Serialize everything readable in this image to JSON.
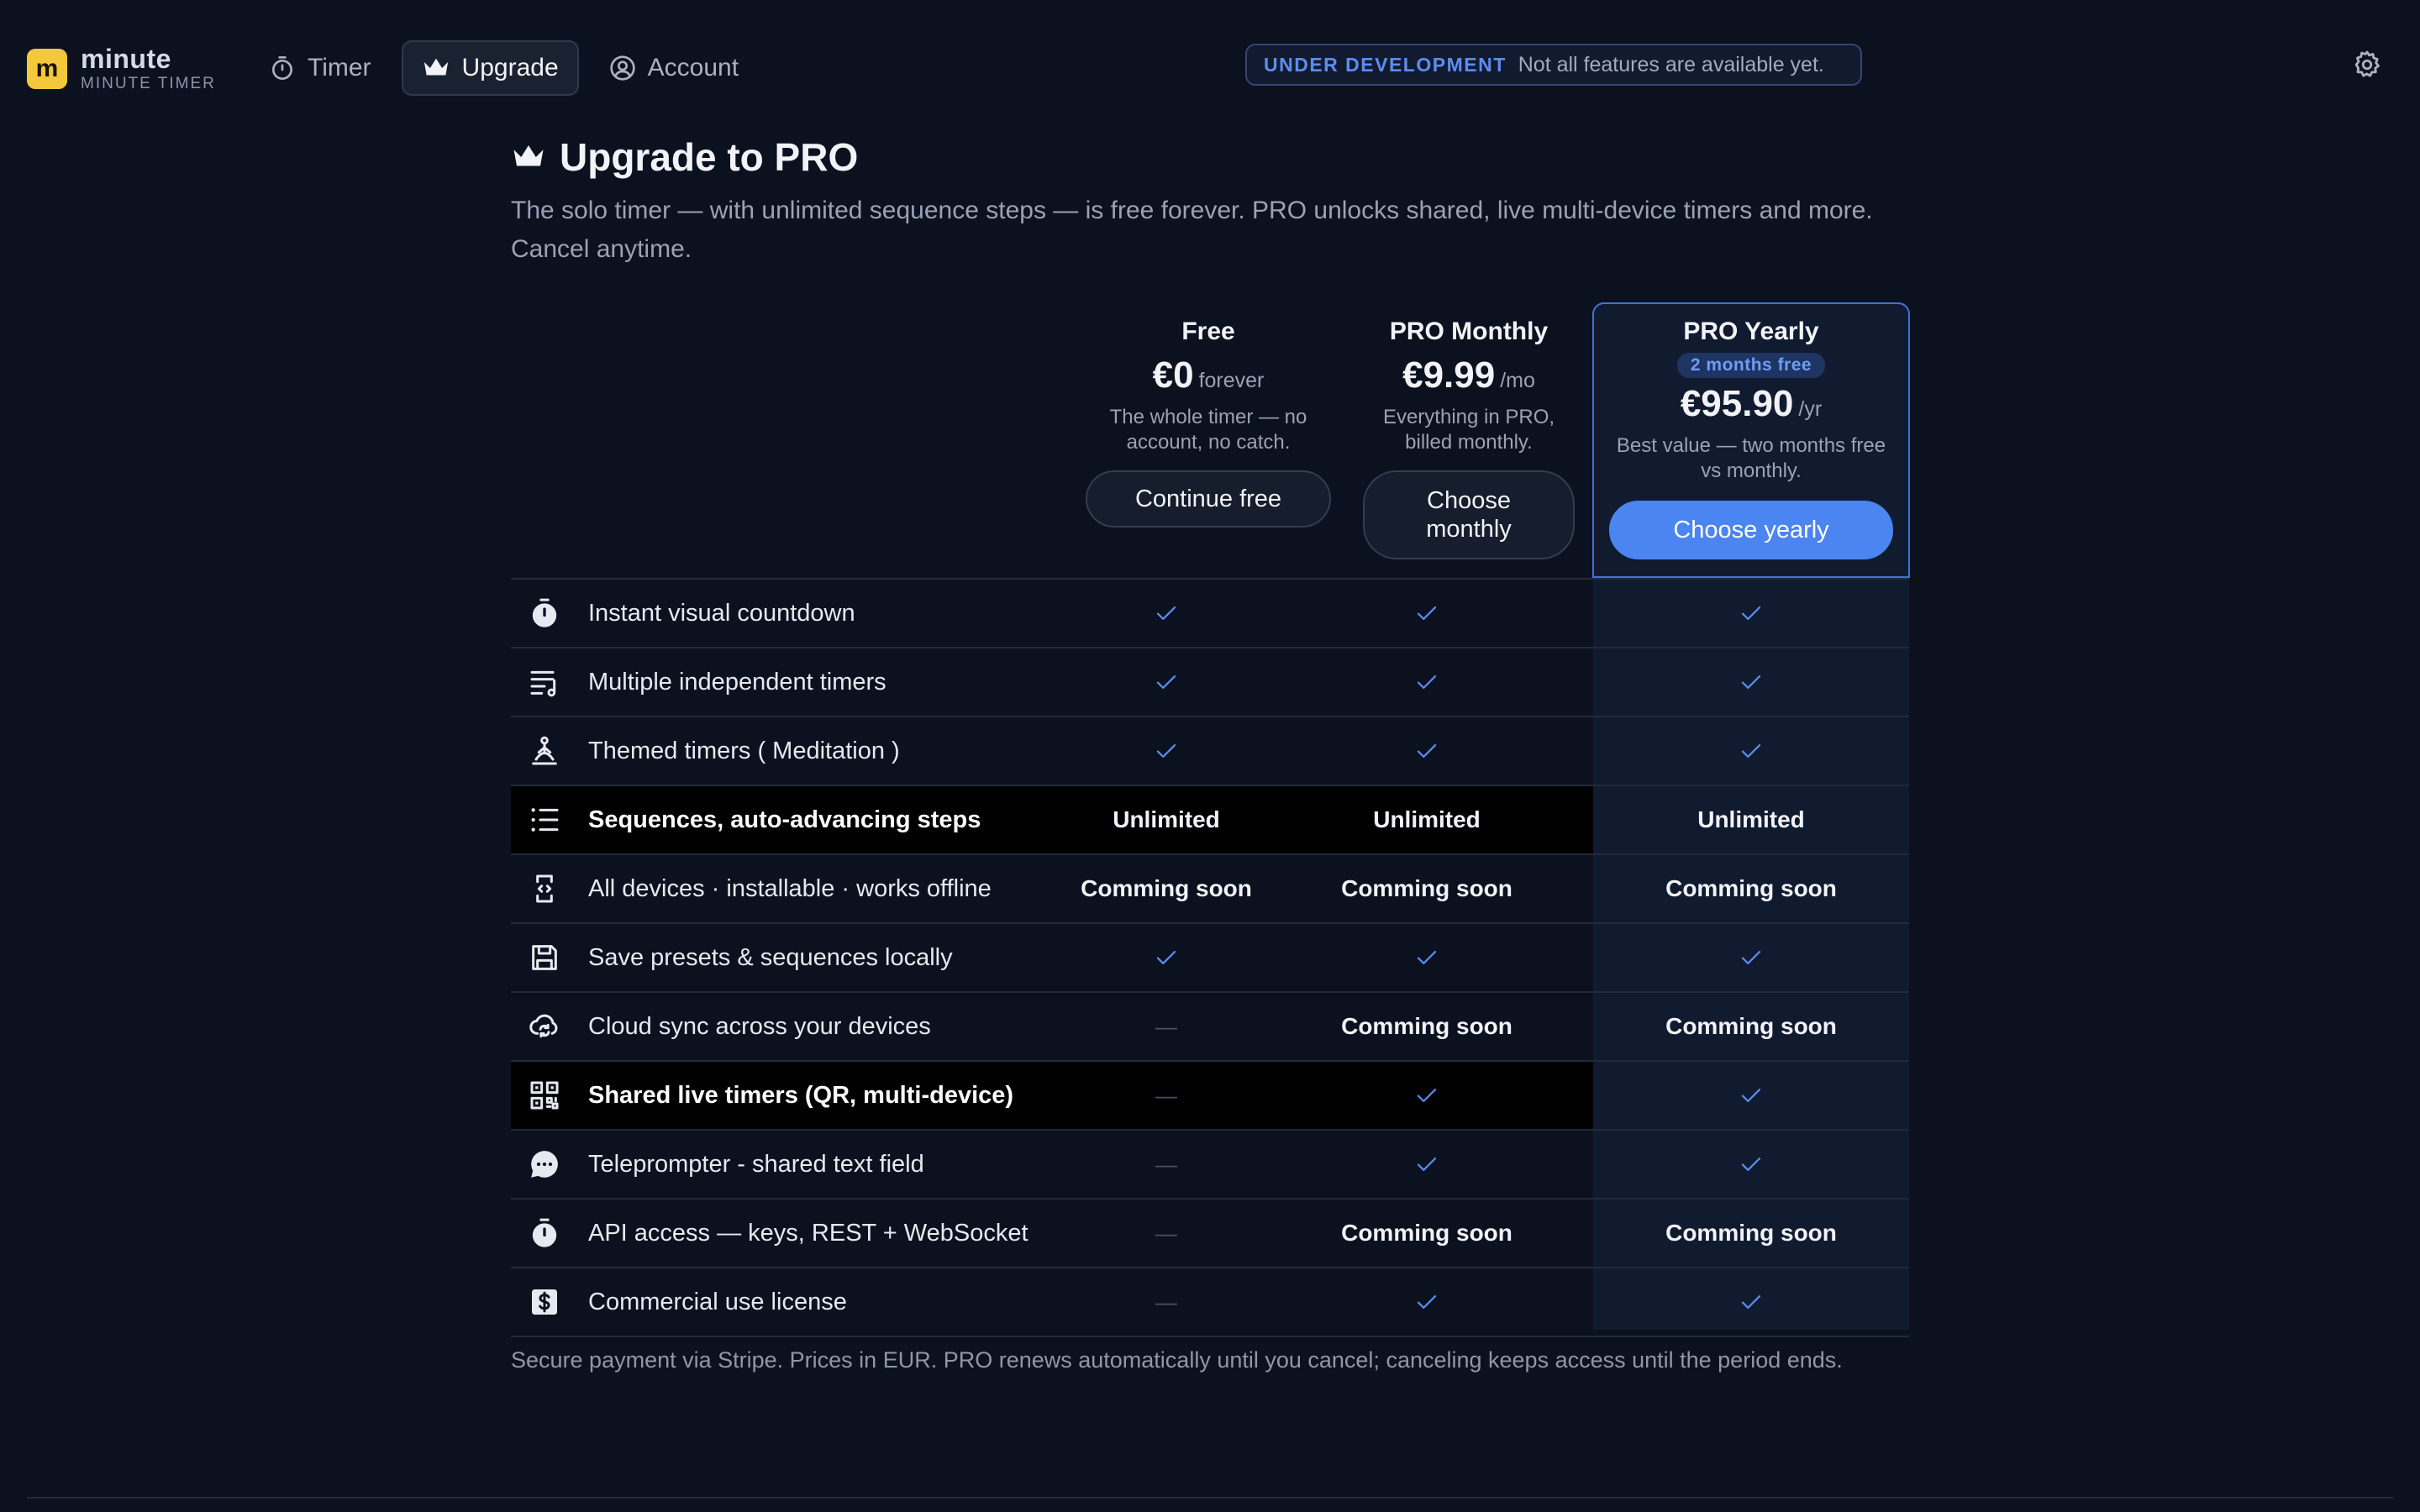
{
  "app": {
    "logo_letter": "m",
    "name": "minute",
    "subtitle": "MINUTE TIMER",
    "brand_color": "#f3c93b",
    "accent_color": "#4a85f2"
  },
  "nav": {
    "items": [
      {
        "label": "Timer",
        "icon": "stopwatch-icon"
      },
      {
        "label": "Upgrade",
        "icon": "crown-icon",
        "active": true
      },
      {
        "label": "Account",
        "icon": "user-circle-icon"
      }
    ]
  },
  "banner": {
    "tag": "UNDER DEVELOPMENT",
    "text": "Not all features are available yet."
  },
  "page": {
    "title": "Upgrade to PRO",
    "subtitle": "The solo timer — with unlimited sequence steps — is free forever. PRO unlocks shared, live multi-device timers and more. Cancel anytime."
  },
  "plans": [
    {
      "name": "Free",
      "price": "€0",
      "period": "forever",
      "description": "The whole timer — no account, no catch.",
      "button": "Continue free"
    },
    {
      "name": "PRO Monthly",
      "price": "€9.99",
      "period": "/mo",
      "description": "Everything in PRO, billed monthly.",
      "button": "Choose monthly"
    },
    {
      "name": "PRO Yearly",
      "badge": "2 months free",
      "price": "€95.90",
      "period": "/yr",
      "description": "Best value — two months free vs monthly.",
      "button": "Choose yearly"
    }
  ],
  "features": [
    {
      "label": "Instant visual countdown",
      "icon": "timer-icon",
      "values": [
        "check",
        "check",
        "check"
      ]
    },
    {
      "label": "Multiple independent timers",
      "icon": "playlist-icon",
      "values": [
        "check",
        "check",
        "check"
      ]
    },
    {
      "label": "Themed timers ( Meditation )",
      "icon": "meditation-icon",
      "values": [
        "check",
        "check",
        "check"
      ]
    },
    {
      "label": "Sequences, auto-advancing steps",
      "icon": "list-icon",
      "highlight": true,
      "values": [
        "Unlimited",
        "Unlimited",
        "Unlimited"
      ]
    },
    {
      "label": "All devices · installable · works offline",
      "icon": "device-code-icon",
      "values": [
        "Comming soon",
        "Comming soon",
        "Comming soon"
      ]
    },
    {
      "label": "Save presets & sequences locally",
      "icon": "save-icon",
      "values": [
        "check",
        "check",
        "check"
      ]
    },
    {
      "label": "Cloud sync across your devices",
      "icon": "cloud-sync-icon",
      "values": [
        "dash",
        "Comming soon",
        "Comming soon"
      ]
    },
    {
      "label": "Shared live timers (QR, multi-device)",
      "icon": "qr-code-icon",
      "highlight": true,
      "values": [
        "dash",
        "check",
        "check"
      ]
    },
    {
      "label": "Teleprompter - shared text field",
      "icon": "chat-bubble-icon",
      "values": [
        "dash",
        "check",
        "check"
      ]
    },
    {
      "label": "API access — keys, REST + WebSocket",
      "icon": "timer-icon",
      "values": [
        "dash",
        "Comming soon",
        "Comming soon"
      ]
    },
    {
      "label": "Commercial use license",
      "icon": "dollar-icon",
      "values": [
        "dash",
        "check",
        "check"
      ]
    }
  ],
  "footer": {
    "note": "Secure payment via Stripe. Prices in EUR. PRO renews automatically until you cancel; canceling keeps access until the period ends."
  }
}
